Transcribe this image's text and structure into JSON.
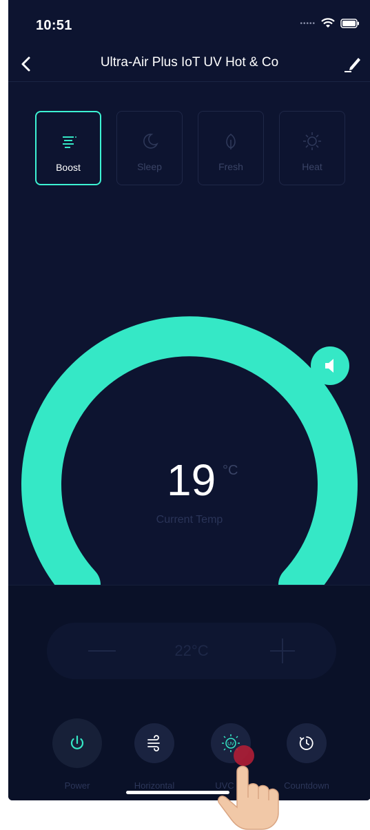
{
  "status_bar": {
    "time": "10:51"
  },
  "header": {
    "title": "Ultra-Air Plus IoT UV Hot & Co"
  },
  "modes": [
    {
      "label": "Boost",
      "icon": "boost-icon",
      "active": true
    },
    {
      "label": "Sleep",
      "icon": "moon-icon",
      "active": false
    },
    {
      "label": "Fresh",
      "icon": "leaf-icon",
      "active": false
    },
    {
      "label": "Heat",
      "icon": "sun-icon",
      "active": false
    }
  ],
  "gauge": {
    "value": "19",
    "unit": "°C",
    "caption": "Current Temp"
  },
  "setpoint": {
    "value": "22°C"
  },
  "controls": [
    {
      "label": "Power",
      "icon": "power-icon"
    },
    {
      "label": "Horizontal",
      "icon": "wind-icon"
    },
    {
      "label": "UVC La",
      "icon": "uv-lamp-icon"
    },
    {
      "label": "Countdown",
      "icon": "timer-icon"
    }
  ],
  "colors": {
    "accent": "#35e8c6",
    "background": "#0d1430",
    "panel": "#0a1128"
  }
}
